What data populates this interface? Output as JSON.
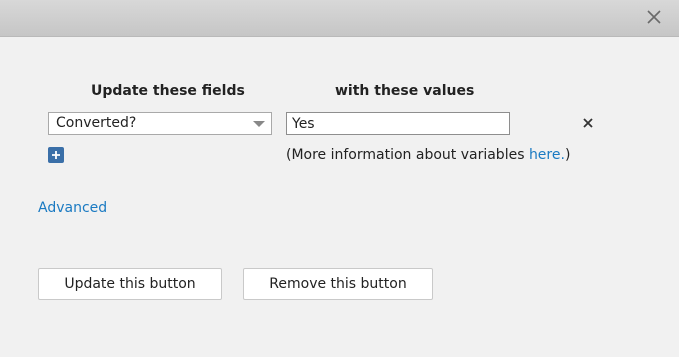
{
  "header": {
    "close_icon": "close-icon"
  },
  "columns": {
    "fields_heading": "Update these fields",
    "values_heading": "with these values"
  },
  "row": {
    "field_selected": "Converted?",
    "value": "Yes"
  },
  "info": {
    "prefix": "(More information about variables ",
    "link": "here.",
    "suffix": ")"
  },
  "advanced_link": "Advanced",
  "buttons": {
    "update": "Update this button",
    "remove": "Remove this button"
  },
  "colors": {
    "link": "#1a7ac2",
    "add_button": "#3a6fa8"
  }
}
